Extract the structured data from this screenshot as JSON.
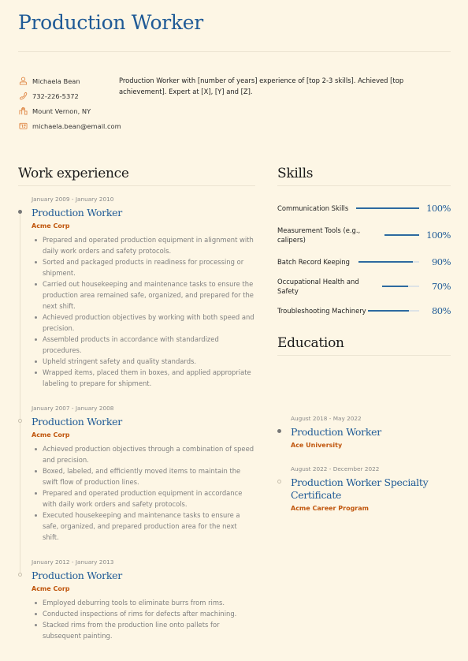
{
  "header": {
    "title": "Production Worker"
  },
  "contact": [
    {
      "icon": "person-icon",
      "text": "Michaela Bean"
    },
    {
      "icon": "phone-icon",
      "text": "732-226-5372"
    },
    {
      "icon": "location-icon",
      "text": "Mount Vernon, NY"
    },
    {
      "icon": "email-icon",
      "text": "michaela.bean@email.com"
    }
  ],
  "summary": "Production Worker with [number of years] experience of [top 2-3 skills]. Achieved [top achievement]. Expert at [X], [Y] and [Z].",
  "work": {
    "heading": "Work experience",
    "entries": [
      {
        "date": "January 2009 - January 2010",
        "title": "Production Worker",
        "company": "Acme Corp",
        "current": true,
        "bullets": [
          "Prepared and operated production equipment in alignment with daily work orders and safety protocols.",
          "Sorted and packaged products in readiness for processing or shipment.",
          "Carried out housekeeping and maintenance tasks to ensure the production area remained safe, organized, and prepared for the next shift.",
          "Achieved production objectives by working with both speed and precision.",
          "Assembled products in accordance with standardized procedures.",
          "Upheld stringent safety and quality standards.",
          "Wrapped items, placed them in boxes, and applied appropriate labeling to prepare for shipment."
        ]
      },
      {
        "date": "January 2007 - January 2008",
        "title": "Production Worker",
        "company": "Acme Corp",
        "current": false,
        "bullets": [
          "Achieved production objectives through a combination of speed and precision.",
          "Boxed, labeled, and efficiently moved items to maintain the swift flow of production lines.",
          "Prepared and operated production equipment in accordance with daily work orders and safety protocols.",
          "Executed housekeeping and maintenance tasks to ensure a safe, organized, and prepared production area for the next shift."
        ]
      },
      {
        "date": "January 2012 - January 2013",
        "title": "Production Worker",
        "company": "Acme Corp",
        "current": false,
        "bullets": [
          "Employed deburring tools to eliminate burrs from rims.",
          "Conducted inspections of rims for defects after machining.",
          "Stacked rims from the production line onto pallets for subsequent painting."
        ]
      }
    ]
  },
  "skills": {
    "heading": "Skills",
    "items": [
      {
        "name": "Communication Skills",
        "percent_label": "100%",
        "level": 1.0
      },
      {
        "name": "Measurement Tools (e.g., calipers)",
        "percent_label": "100%",
        "level": 1.0
      },
      {
        "name": "Batch Record Keeping",
        "percent_label": "90%",
        "level": 0.9
      },
      {
        "name": "Occupational Health and Safety",
        "percent_label": "70%",
        "level": 0.7
      },
      {
        "name": "Troubleshooting Machinery",
        "percent_label": "80%",
        "level": 0.8
      }
    ]
  },
  "education": {
    "heading": "Education",
    "entries": [
      {
        "date": "August 2018 - May 2022",
        "title": "Production Worker",
        "school": "Ace University",
        "current": true
      },
      {
        "date": "August 2022 - December 2022",
        "title": "Production Worker Specialty Certificate",
        "school": "Acme Career Program",
        "current": false
      }
    ]
  },
  "colors": {
    "background": "#fdf6e5",
    "accent_blue": "#1f5a96",
    "accent_orange": "#c0560d",
    "icon_orange": "#e08a4a"
  }
}
